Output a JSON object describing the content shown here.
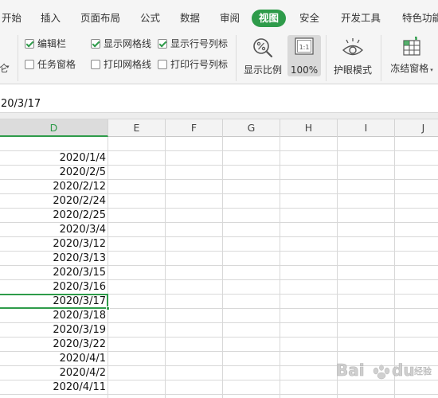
{
  "tabs": [
    {
      "label": "开始",
      "active": false
    },
    {
      "label": "插入",
      "active": false
    },
    {
      "label": "页面布局",
      "active": false
    },
    {
      "label": "公式",
      "active": false
    },
    {
      "label": "数据",
      "active": false
    },
    {
      "label": "审阅",
      "active": false
    },
    {
      "label": "视图",
      "active": true
    },
    {
      "label": "安全",
      "active": false
    },
    {
      "label": "开发工具",
      "active": false
    },
    {
      "label": "特色功能",
      "active": false
    }
  ],
  "ribbon": {
    "left_fragment": "仑",
    "checkboxes": [
      {
        "label": "编辑栏",
        "checked": true
      },
      {
        "label": "任务窗格",
        "checked": false
      },
      {
        "label": "显示网格线",
        "checked": true
      },
      {
        "label": "打印网格线",
        "checked": false
      },
      {
        "label": "显示行号列标",
        "checked": true
      },
      {
        "label": "打印行号列标",
        "checked": false
      }
    ],
    "buttons": {
      "zoom_ratio": "显示比例",
      "zoom_100": "100%",
      "zoom_100_icon_text": "1:1",
      "eye_mode": "护眼模式",
      "freeze": "冻结窗格"
    }
  },
  "formula_bar": {
    "value": "20/3/17"
  },
  "columns": [
    "D",
    "E",
    "F",
    "G",
    "H",
    "I",
    "J"
  ],
  "selected_column": "D",
  "dates": [
    "2020/1/4",
    "2020/2/5",
    "2020/2/12",
    "2020/2/24",
    "2020/2/25",
    "2020/3/4",
    "2020/3/12",
    "2020/3/13",
    "2020/3/15",
    "2020/3/16",
    "2020/3/17",
    "2020/3/18",
    "2020/3/19",
    "2020/3/22",
    "2020/4/1",
    "2020/4/2",
    "2020/4/11"
  ],
  "active_row_index": 10,
  "watermark": {
    "brand": "Bai",
    "brand_suffix": "du",
    "sub": "经验"
  },
  "colors": {
    "accent": "#2e9b4a",
    "ribbon_bg": "#f5f5f5",
    "grid_line": "#d8d8d8"
  }
}
